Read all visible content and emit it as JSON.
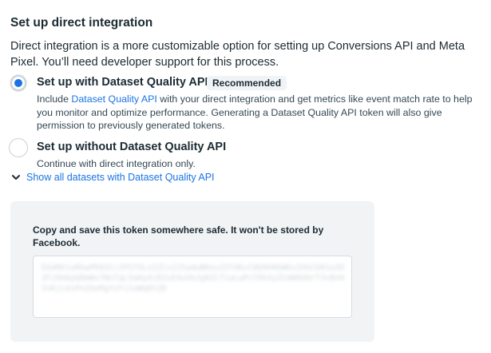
{
  "section": {
    "title": "Set up direct integration",
    "description": "Direct integration is a more customizable option for setting up Conversions API and Meta Pixel. You’ll need developer support for this process."
  },
  "options": [
    {
      "label": "Set up with Dataset Quality API",
      "badge": "Recommended",
      "selected": true,
      "sub_prefix": "Include ",
      "sub_link": "Dataset Quality API",
      "sub_suffix": " with your direct integration and get metrics like event match rate to help you monitor and optimize performance. Generating a Dataset Quality API token will also give permission to previously generated tokens."
    },
    {
      "label": "Set up without Dataset Quality API",
      "selected": false,
      "sub": "Continue with direct integration only."
    }
  ],
  "show_all": {
    "label": "Show all datasets with Dataset Quality API",
    "icon": "chevron-down-icon"
  },
  "token_panel": {
    "note": "Copy and save this token somewhere safe. It won't be stored by Facebook.",
    "token_value": "EAAMX1oRhwPK0ZCcIPSTXLxZZCx1ZIwdwBKeu2ZYd6vC8Q9hRGW6xZAhCbR1oZD3Fz9kKpQ8mWv7NnTqL5aHyXcR2sE4uVbJg8ZCf1aLwPzT0kXyZCmN9dQrT3vBnH2sKjL6xPoZAeRgYvFi1uWq8tZD"
  },
  "colors": {
    "accent": "#1b74e4",
    "text": "#1c2b33",
    "panel_bg": "#f1f3f5"
  }
}
